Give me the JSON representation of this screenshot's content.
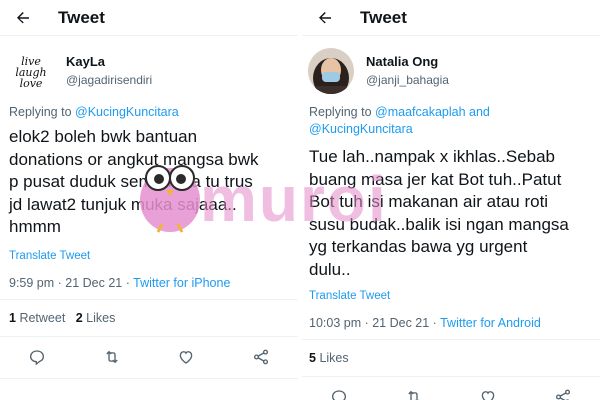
{
  "left": {
    "header_title": "Tweet",
    "display_name": "KayLa",
    "handle": "@jagadirisendiri",
    "replying_prefix": "Replying to ",
    "replying_to": "@KucingKuncitara",
    "body_lines": [
      "elok2 boleh bwk bantuan",
      "donations or angkut mangsa bwk",
      "p pusat duduk sementara tu trus",
      "jd lawat2 tunjuk muka sajaaa..",
      "hmmm"
    ],
    "translate": "Translate Tweet",
    "time_date": "9:59 pm · 21 Dec 21 · ",
    "source": "Twitter for iPhone",
    "retweet_count": "1",
    "retweet_label": "Retweet",
    "like_count": "2",
    "like_label": "Likes"
  },
  "right": {
    "header_title": "Tweet",
    "display_name": "Natalia Ong",
    "handle": "@janji_bahagia",
    "replying_prefix": "Replying to ",
    "replying_to_1": "@maafcakaplah and",
    "replying_to_2": "@KucingKuncitara",
    "body_lines": [
      "Tue lah..nampak x ikhlas..Sebab",
      "buang masa jer kat Bot tuh..Patut",
      "Bot tuh isi makanan air atau roti",
      "susu budak..balik isi ngan mangsa",
      "yg terkandas bawa yg urgent",
      "dulu.."
    ],
    "translate": "Translate Tweet",
    "time_date": "10:03 pm · 21 Dec 21 · ",
    "source": "Twitter for Android",
    "like_count": "5",
    "like_label": "Likes"
  },
  "watermark": "muroi",
  "icons": {
    "back": "back-arrow-icon",
    "reply": "reply-icon",
    "retweet": "retweet-icon",
    "like": "heart-icon",
    "share": "share-icon"
  },
  "colors": {
    "link": "#1d9bf0",
    "secondary_text": "#536471",
    "watermark": "#e48ac8"
  }
}
